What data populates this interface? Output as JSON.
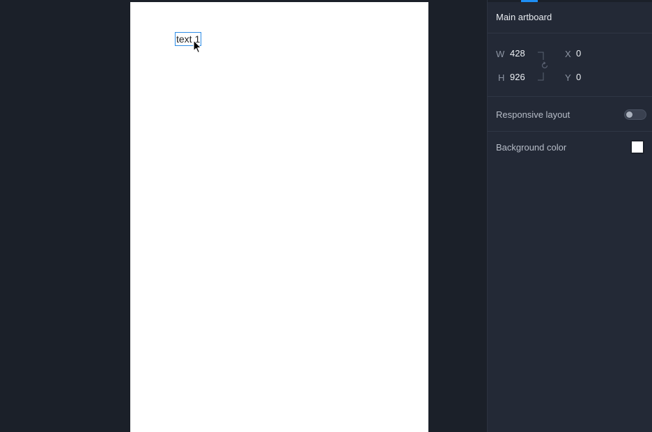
{
  "canvas": {
    "text_layer": "text 1",
    "artboard_background": "#ffffff",
    "selection_color": "#2d8ce6"
  },
  "panel": {
    "title": "Main artboard",
    "dimensions": {
      "w_label": "W",
      "w_value": "428",
      "h_label": "H",
      "h_value": "926",
      "x_label": "X",
      "x_value": "0",
      "y_label": "Y",
      "y_value": "0"
    },
    "responsive_layout": {
      "label": "Responsive layout",
      "enabled": false
    },
    "background_color": {
      "label": "Background color",
      "value": "#ffffff"
    }
  },
  "icons": [
    "cursor-arrow-icon",
    "link-bracket-icon",
    "rotate-icon"
  ],
  "colors": {
    "canvas_bg": "#1b2029",
    "panel_bg": "#232936",
    "accent": "#1e8ff5"
  }
}
